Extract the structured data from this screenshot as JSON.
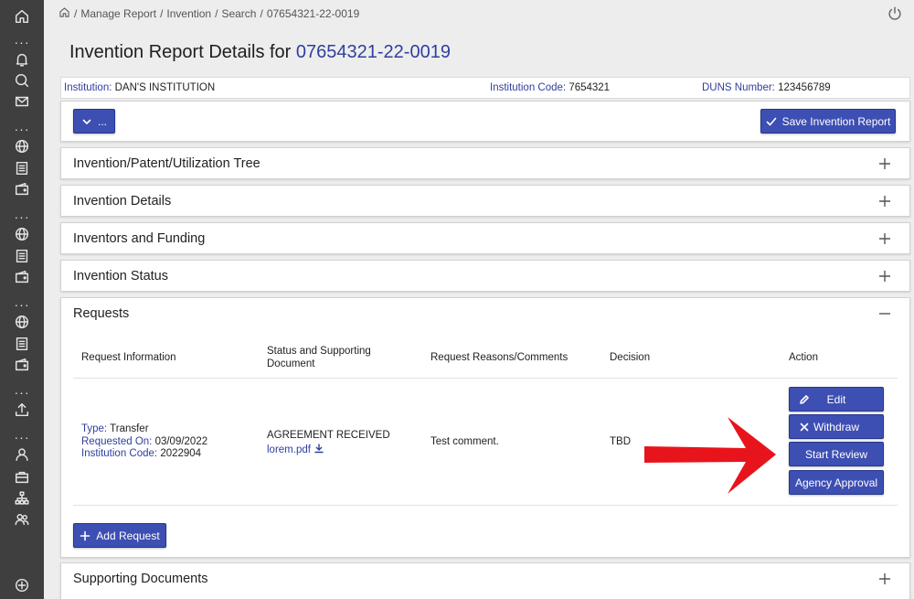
{
  "breadcrumb": [
    "Manage Report",
    "Invention",
    "Search",
    "07654321-22-0019"
  ],
  "title": {
    "prefix": "Invention Report Details for",
    "number": "07654321-22-0019"
  },
  "info": {
    "institution_label": "Institution:",
    "institution_value": "DAN'S INSTITUTION",
    "code_label": "Institution Code:",
    "code_value": "7654321",
    "duns_label": "DUNS Number:",
    "duns_value": "123456789"
  },
  "toolbar": {
    "dropdown_label": "...",
    "save_label": "Save Invention Report"
  },
  "sections": {
    "tree": "Invention/Patent/Utilization Tree",
    "details": "Invention Details",
    "inventors": "Inventors and Funding",
    "status": "Invention Status",
    "requests": "Requests",
    "supporting": "Supporting Documents"
  },
  "requests_table": {
    "headers": [
      "Request Information",
      "Status and Supporting Document",
      "Request Reasons/Comments",
      "Decision",
      "Action"
    ],
    "row": {
      "type_label": "Type:",
      "type_value": "Transfer",
      "requested_label": "Requested On:",
      "requested_value": "03/09/2022",
      "code_label": "Institution Code:",
      "code_value": "2022904",
      "status": "AGREEMENT RECEIVED",
      "document": "lorem.pdf",
      "comment": "Test comment.",
      "decision": "TBD"
    },
    "actions": {
      "edit": "Edit",
      "withdraw": "Withdraw",
      "start_review": "Start Review",
      "agency_approval": "Agency Approval"
    },
    "add_request": "Add Request"
  },
  "colors": {
    "accent": "#3e4fb3",
    "link": "#2f3f9e",
    "sidebar": "#3f3f3f",
    "annotation_arrow": "#e8141c"
  }
}
